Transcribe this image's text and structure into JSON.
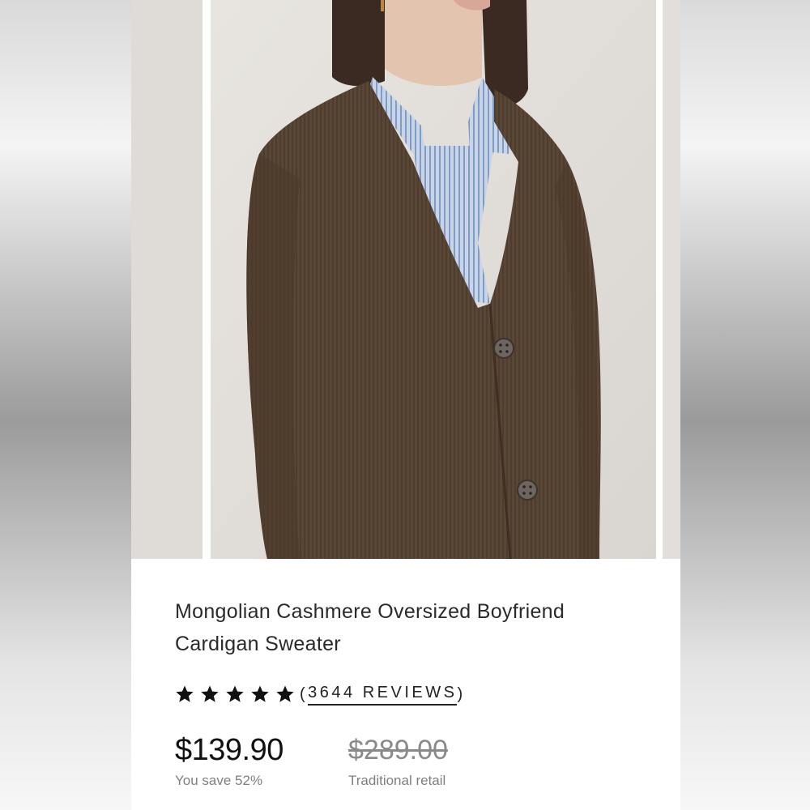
{
  "product": {
    "title": "Mongolian Cashmere Oversized Boyfriend Cardigan Sweater",
    "rating": 5,
    "rating_max": 5,
    "reviews_open": "(",
    "reviews_label": "3644 REVIEWS",
    "reviews_close": ")",
    "price": "$139.90",
    "savings": "You save 52%",
    "traditional_price": "$289.00",
    "traditional_label": "Traditional retail"
  },
  "icons": {
    "star": "star-icon"
  },
  "colors": {
    "text": "#2a2a2a",
    "muted": "#7f7f7f",
    "sweater": "#5a4636",
    "shirt": "#a9bcd8"
  }
}
